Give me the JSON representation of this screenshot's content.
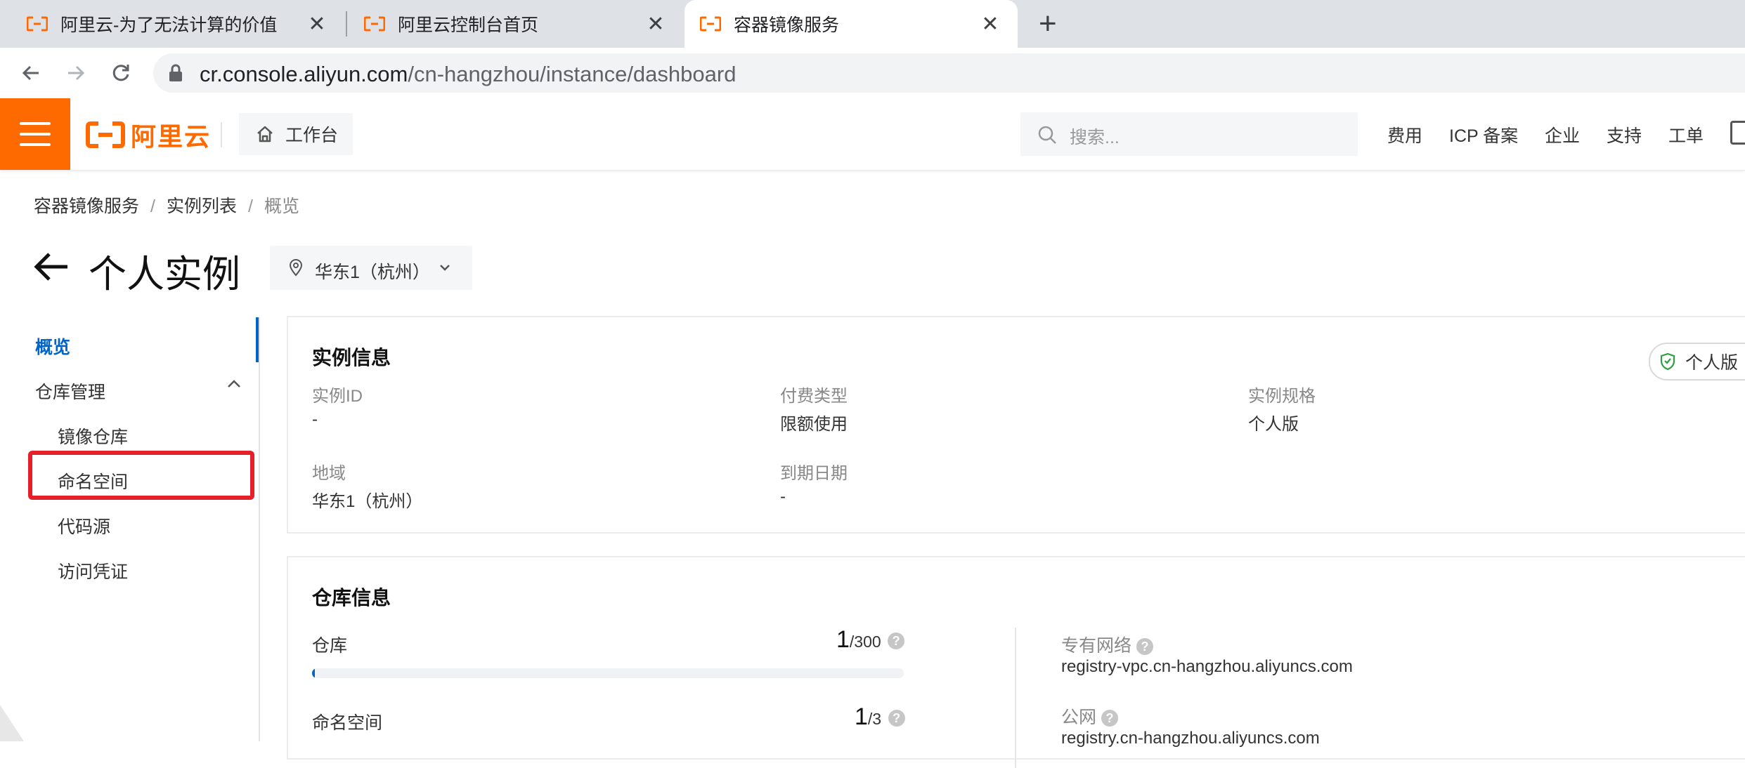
{
  "browser": {
    "tabs": [
      {
        "title": "阿里云-为了无法计算的价值",
        "active": false
      },
      {
        "title": "阿里云控制台首页",
        "active": false
      },
      {
        "title": "容器镜像服务",
        "active": true
      }
    ],
    "close_glyph": "✕",
    "new_tab_glyph": "+",
    "url_host": "cr.console.aliyun.com",
    "url_path": "/cn-hangzhou/instance/dashboard"
  },
  "topnav": {
    "logo_text": "阿里云",
    "workbench_label": "工作台",
    "search_placeholder": "搜索...",
    "menu": [
      "费用",
      "ICP 备案",
      "企业",
      "支持",
      "工单"
    ],
    "accent": "#ff6a00"
  },
  "breadcrumb": [
    "容器镜像服务",
    "实例列表",
    "概览"
  ],
  "page": {
    "title": "个人实例",
    "region": "华东1（杭州）"
  },
  "sidebar": {
    "overview": "概览",
    "repo_group": "仓库管理",
    "sub_items": [
      "镜像仓库",
      "命名空间",
      "代码源",
      "访问凭证"
    ],
    "active_color": "#0064c8",
    "highlight_color": "#e5202a"
  },
  "instance_info": {
    "title": "实例信息",
    "badge": "个人版",
    "fields": [
      {
        "label": "实例ID",
        "value": "-"
      },
      {
        "label": "付费类型",
        "value": "限额使用"
      },
      {
        "label": "实例规格",
        "value": "个人版"
      },
      {
        "label": "地域",
        "value": "华东1（杭州）"
      },
      {
        "label": "到期日期",
        "value": "-"
      }
    ]
  },
  "repo_info": {
    "title": "仓库信息",
    "stats": [
      {
        "label": "仓库",
        "used": "1",
        "limit": "/300",
        "fraction": 0.0033
      },
      {
        "label": "命名空间",
        "used": "1",
        "limit": "/3"
      }
    ],
    "endpoints": [
      {
        "label": "专有网络",
        "value": "registry-vpc.cn-hangzhou.aliyuncs.com"
      },
      {
        "label": "公网",
        "value": "registry.cn-hangzhou.aliyuncs.com"
      }
    ],
    "help_glyph": "?"
  }
}
